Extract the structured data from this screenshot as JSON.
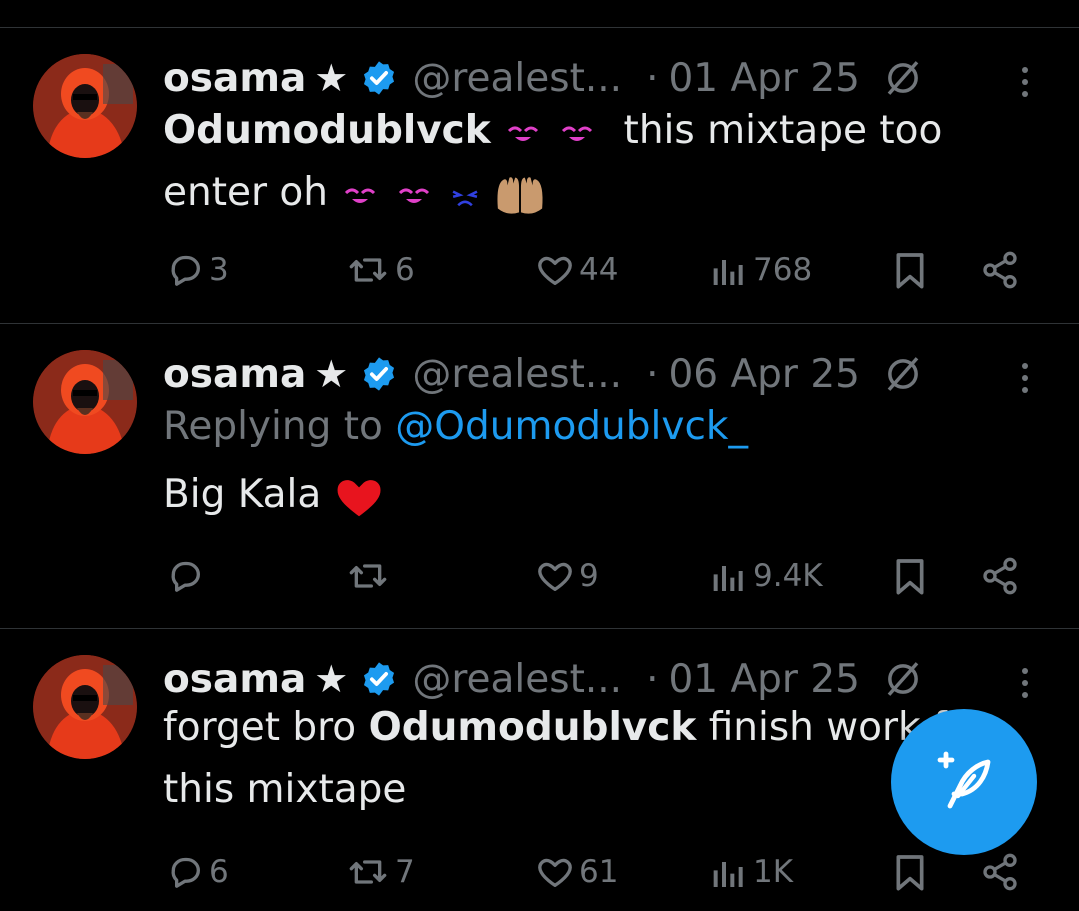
{
  "tweets": [
    {
      "name": "osama",
      "star": "★",
      "handle": "@realest...",
      "dot": "·",
      "date": "01 Apr 25",
      "text_bold": "Odumodublvck",
      "text_rest": "this mixtape too",
      "text_line2": "enter oh",
      "replies": "3",
      "retweets": "6",
      "likes": "44",
      "views": "768"
    },
    {
      "name": "osama",
      "star": "★",
      "handle": "@realest...",
      "dot": "·",
      "date": "06 Apr 25",
      "replying_prefix": "Replying to",
      "replying_handle": "@Odumodublvck_",
      "text": "Big Kala",
      "replies": "",
      "retweets": "",
      "likes": "9",
      "views": "9.4K"
    },
    {
      "name": "osama",
      "star": "★",
      "handle": "@realest...",
      "dot": "·",
      "date": "01 Apr 25",
      "text_prefix": "forget bro",
      "text_bold": "Odumodublvck",
      "text_rest": "finish work for",
      "text_line2": "this mixtape",
      "replies": "6",
      "retweets": "7",
      "likes": "61",
      "views": "1K"
    }
  ],
  "colors": {
    "background": "#000000",
    "text": "#e7e9ea",
    "muted": "#71767b",
    "accent": "#1d9bf0",
    "separator": "#2f3336"
  },
  "icons": [
    "reply-icon",
    "retweet-icon",
    "like-icon",
    "views-icon",
    "bookmark-icon",
    "share-icon",
    "verified-icon",
    "grok-icon",
    "more-icon",
    "compose-icon"
  ]
}
